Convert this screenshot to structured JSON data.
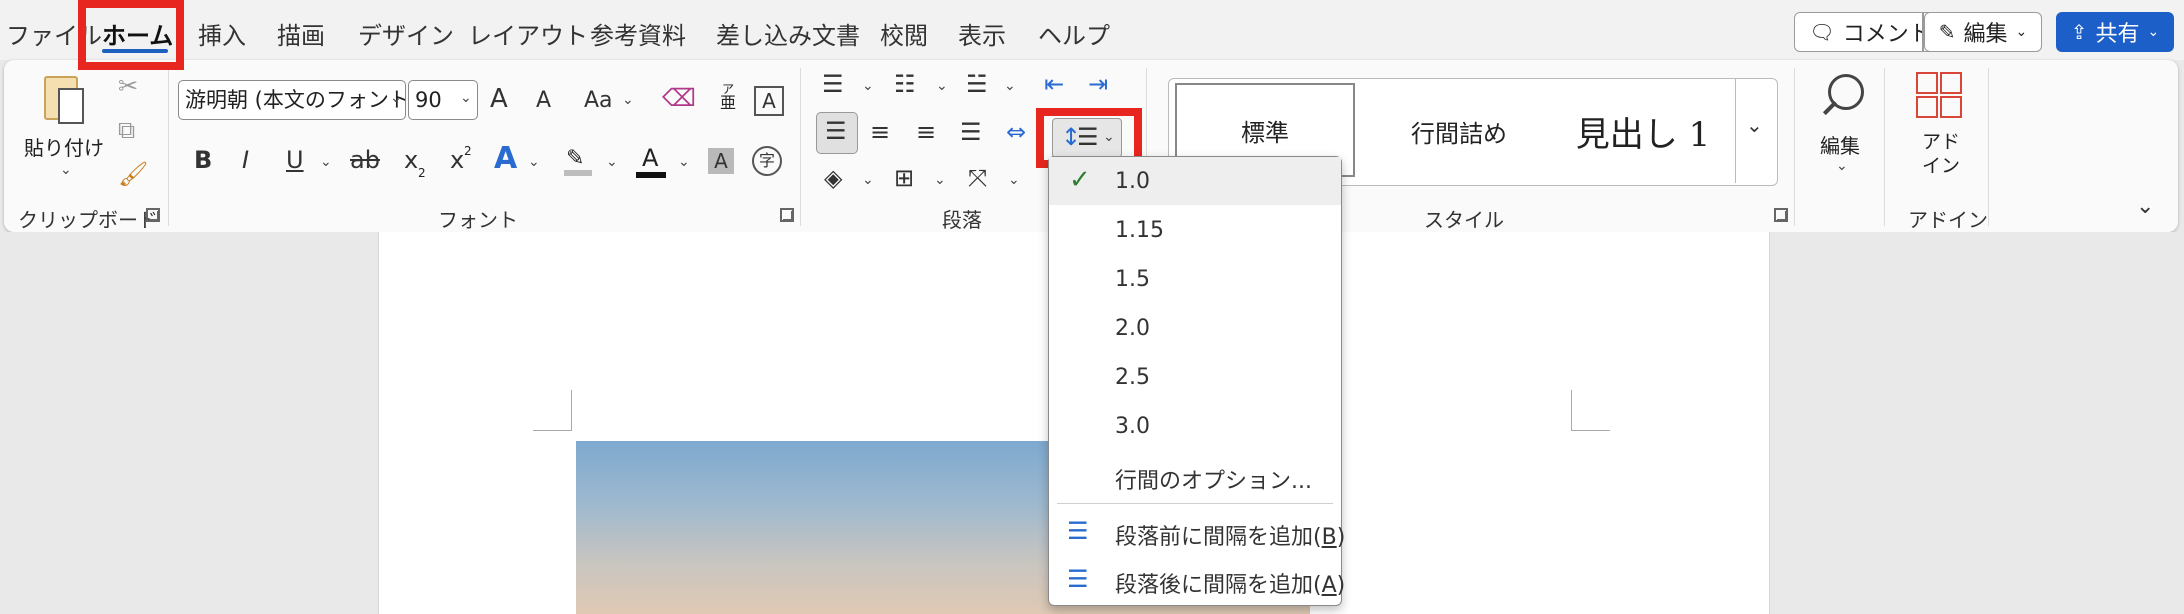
{
  "menu": {
    "items": [
      "ファイル",
      "ホーム",
      "挿入",
      "描画",
      "デザイン",
      "レイアウト",
      "参考資料",
      "差し込み文書",
      "校閲",
      "表示",
      "ヘルプ"
    ],
    "active_index": 1
  },
  "top_buttons": {
    "comment": "コメント",
    "edit": "編集",
    "share": "共有"
  },
  "ribbon": {
    "clipboard": {
      "paste_label": "貼り付け",
      "group_label": "クリップボード"
    },
    "font": {
      "font_name": "游明朝 (本文のフォント",
      "font_size": "90",
      "grow": "A",
      "shrink": "A",
      "change_case": "Aa",
      "bold": "B",
      "italic": "I",
      "underline": "U",
      "strike": "ab",
      "subscript": "x",
      "superscript": "x",
      "effect": "A",
      "font_color": "A",
      "char_shading": "A",
      "enclose": "字",
      "phonetic_top": "ア",
      "phonetic_bottom": "亜",
      "char_border": "A",
      "group_label": "フォント"
    },
    "paragraph": {
      "group_label": "段落"
    },
    "styles": {
      "items": [
        "標準",
        "行間詰め",
        "見出し 1"
      ],
      "group_label": "スタイル"
    },
    "editing": {
      "label": "編集"
    },
    "addins": {
      "button_line1": "アド",
      "button_line2": "イン",
      "group_label": "アドイン"
    }
  },
  "line_spacing_menu": {
    "options": [
      "1.0",
      "1.15",
      "1.5",
      "2.0",
      "2.5",
      "3.0"
    ],
    "selected": "1.0",
    "options_item": "行間のオプション...",
    "add_before_prefix": "段落前に間隔を追加(",
    "add_before_key": "B",
    "add_after_prefix": "段落後に間隔を追加(",
    "add_after_key": "A",
    "close_paren": ")"
  },
  "colors": {
    "accent": "#1f5fbf",
    "highlight_box": "#e6261f",
    "check": "#2e7d32"
  }
}
